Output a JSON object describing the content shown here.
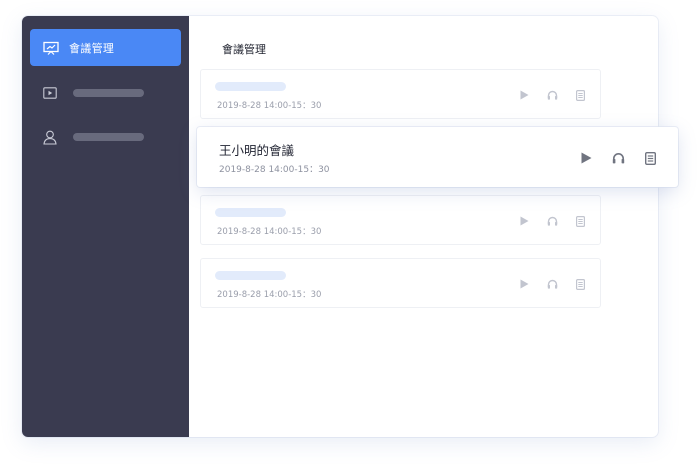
{
  "sidebar": {
    "active_item": {
      "label": "會議管理",
      "icon": "presentation-chart-icon"
    },
    "items": [
      {
        "icon": "video-play-icon"
      },
      {
        "icon": "user-icon"
      }
    ]
  },
  "main": {
    "title": "會議管理",
    "meetings": [
      {
        "time": "2019-8-28 14:00-15：30"
      },
      {
        "time": "2019-8-28 14:00-15：30"
      },
      {
        "time": "2019-8-28 14:00-15：30"
      }
    ],
    "highlighted_meeting": {
      "name": "王小明的會議",
      "time": "2019-8-28 14:00-15：30"
    }
  },
  "colors": {
    "sidebar_bg": "#3a3b50",
    "accent": "#4a88f5",
    "placeholder_pill": "#e2ebfb"
  }
}
